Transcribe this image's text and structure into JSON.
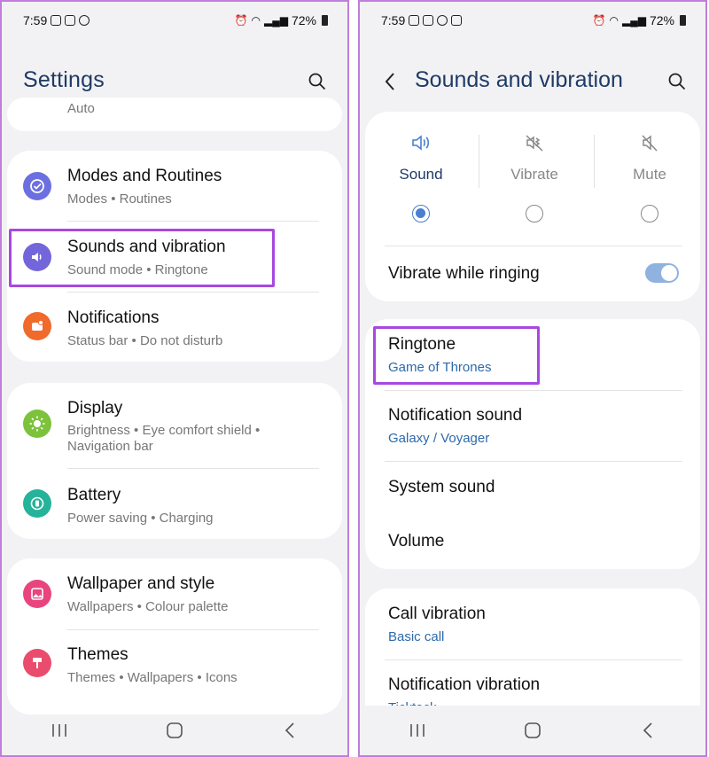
{
  "left": {
    "status": {
      "time": "7:59",
      "battery": "72%"
    },
    "title": "Settings",
    "clipped_text": "Auto",
    "items": [
      {
        "title": "Modes and Routines",
        "sub": [
          "Modes",
          "Routines"
        ],
        "icon": "modes-routines-icon",
        "color": "#6c6fe0"
      },
      {
        "title": "Sounds and vibration",
        "sub": [
          "Sound mode",
          "Ringtone"
        ],
        "icon": "speaker-icon",
        "color": "#7366db"
      },
      {
        "title": "Notifications",
        "sub": [
          "Status bar",
          "Do not disturb"
        ],
        "icon": "notification-icon",
        "color": "#f06a2c"
      },
      {
        "title": "Display",
        "sub": [
          "Brightness",
          "Eye comfort shield",
          "Navigation bar"
        ],
        "icon": "sun-icon",
        "color": "#7cc23c"
      },
      {
        "title": "Battery",
        "sub": [
          "Power saving",
          "Charging"
        ],
        "icon": "battery-icon",
        "color": "#25b39a"
      },
      {
        "title": "Wallpaper and style",
        "sub": [
          "Wallpapers",
          "Colour palette"
        ],
        "icon": "wallpaper-icon",
        "color": "#e8457e"
      },
      {
        "title": "Themes",
        "sub": [
          "Themes",
          "Wallpapers",
          "Icons"
        ],
        "icon": "themes-icon",
        "color": "#ea4c6d"
      }
    ],
    "sub_text": {
      "modes": "Modes  •  Routines",
      "sounds": "Sound mode  •  Ringtone",
      "notifications": "Status bar  •  Do not disturb",
      "display_1": "Brightness  •  Eye comfort shield  •",
      "display_2": "Navigation bar",
      "battery": "Power saving  •  Charging",
      "wallpaper": "Wallpapers  •  Colour palette",
      "themes": "Themes  •  Wallpapers  •  Icons"
    }
  },
  "right": {
    "status": {
      "time": "7:59",
      "battery": "72%"
    },
    "title": "Sounds and vibration",
    "modes": [
      {
        "label": "Sound",
        "selected": true
      },
      {
        "label": "Vibrate",
        "selected": false
      },
      {
        "label": "Mute",
        "selected": false
      }
    ],
    "vibrate_while_ringing": {
      "label": "Vibrate while ringing",
      "on": true
    },
    "ringtone": {
      "label": "Ringtone",
      "value": "Game of Thrones"
    },
    "notification_sound": {
      "label": "Notification sound",
      "value": "Galaxy / Voyager"
    },
    "system_sound": {
      "label": "System sound"
    },
    "volume": {
      "label": "Volume"
    },
    "call_vibration": {
      "label": "Call vibration",
      "value": "Basic call"
    },
    "notification_vibration": {
      "label": "Notification vibration",
      "value": "Ticktock"
    }
  },
  "colors": {
    "accent": "#4a7ecf",
    "highlight": "#a748e0",
    "title": "#1e3a66",
    "subvalue": "#2c6aab"
  }
}
